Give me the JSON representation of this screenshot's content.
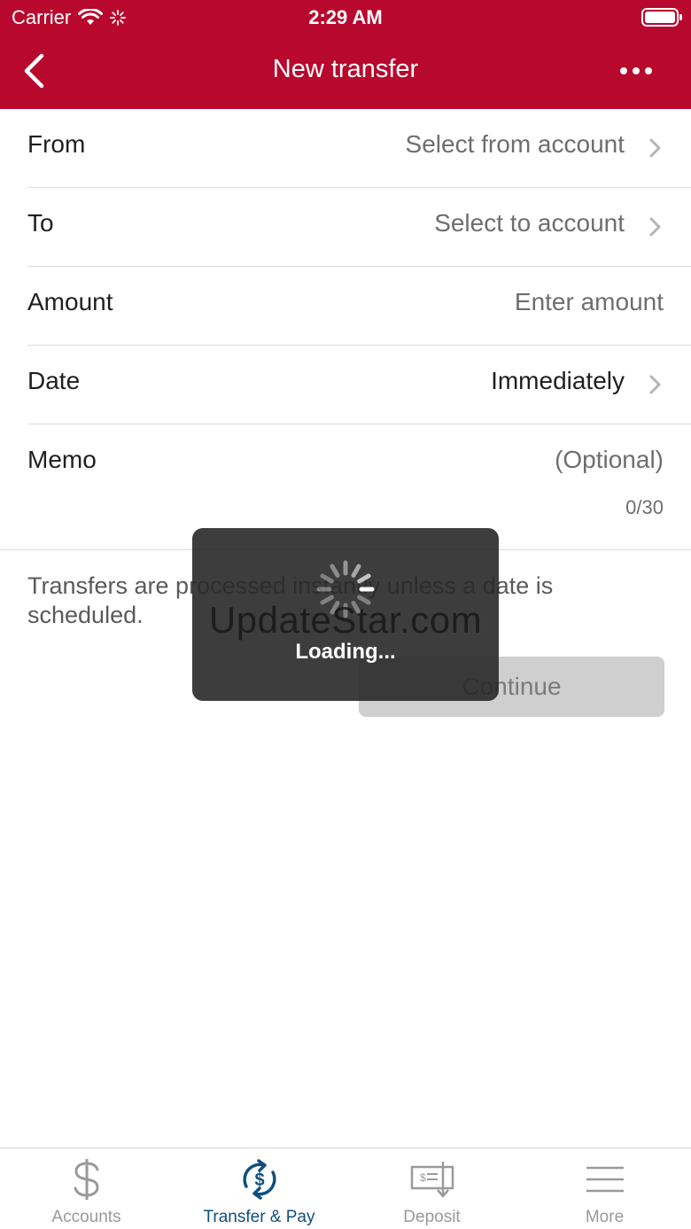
{
  "status_bar": {
    "carrier": "Carrier",
    "time": "2:29 AM"
  },
  "header": {
    "title": "New transfer",
    "back_icon": "chevron-left-icon",
    "more_icon": "more-dots-icon",
    "background_color": "#b8082d"
  },
  "form": {
    "from": {
      "label": "From",
      "value": "Select from account"
    },
    "to": {
      "label": "To",
      "value": "Select to account"
    },
    "amount": {
      "label": "Amount",
      "placeholder": "Enter amount"
    },
    "date": {
      "label": "Date",
      "value": "Immediately"
    },
    "memo": {
      "label": "Memo",
      "placeholder": "(Optional)",
      "counter": "0/30"
    }
  },
  "info_text": "Transfers are processed instantly unless a date is scheduled.",
  "continue_label": "Continue",
  "overlay": {
    "loading_text": "Loading...",
    "watermark": "UpdateStar.com"
  },
  "tabbar": {
    "tabs": [
      {
        "label": "Accounts",
        "icon": "dollar-icon",
        "active": false
      },
      {
        "label": "Transfer & Pay",
        "icon": "transfer-icon",
        "active": true
      },
      {
        "label": "Deposit",
        "icon": "check-deposit-icon",
        "active": false
      },
      {
        "label": "More",
        "icon": "menu-icon",
        "active": false
      }
    ],
    "active_color": "#0f4f7d",
    "inactive_color": "#9a9a9a"
  }
}
